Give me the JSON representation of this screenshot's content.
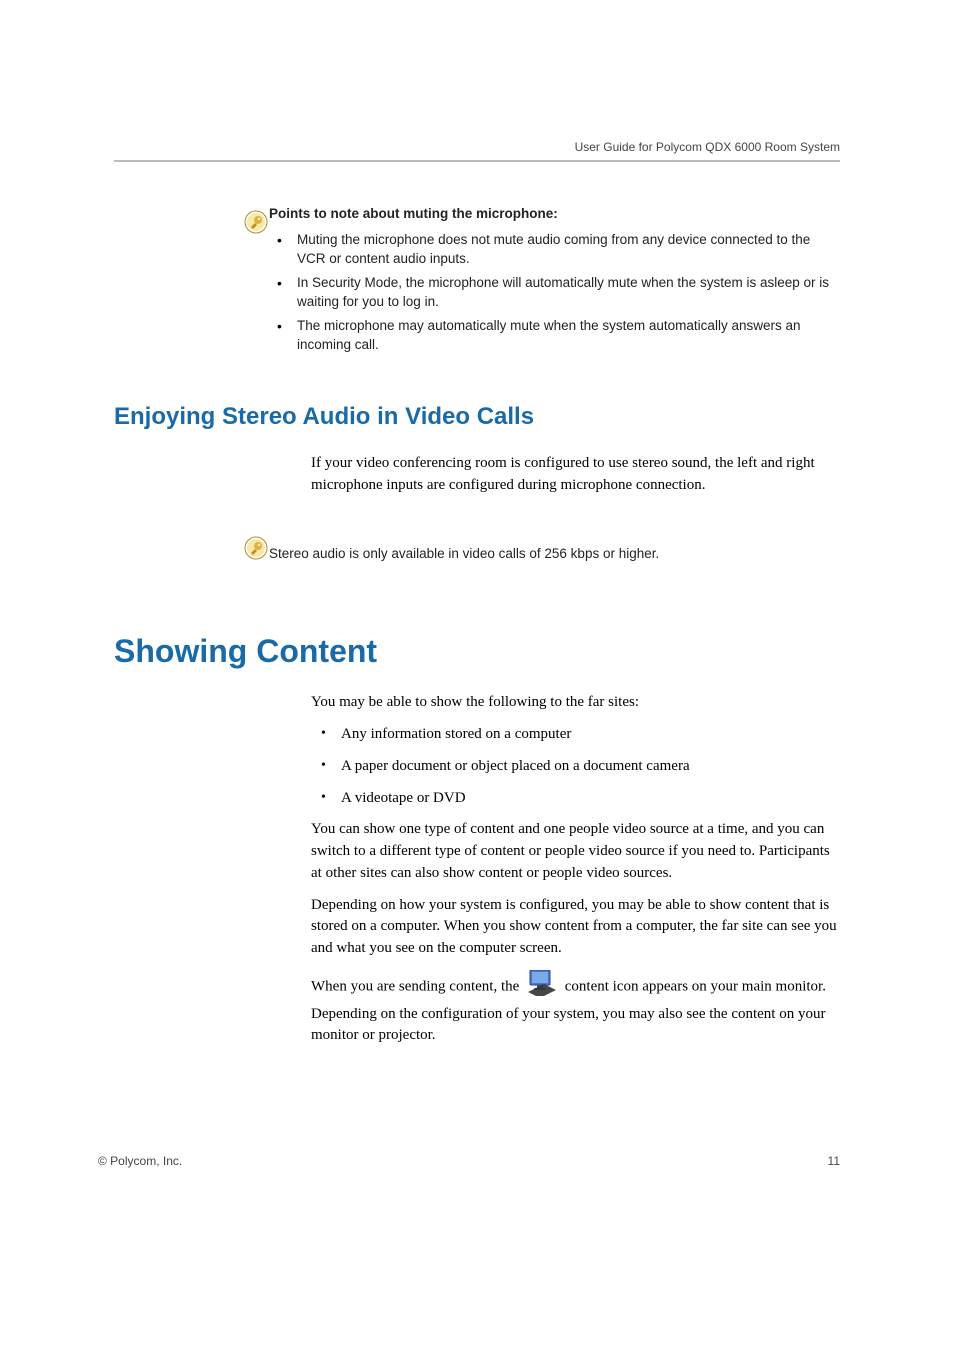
{
  "header": {
    "title": "User Guide for Polycom QDX 6000 Room System"
  },
  "note1": {
    "title": "Points to note about muting the microphone:",
    "items": [
      "Muting the microphone does not mute audio coming from any device connected to the VCR or content audio inputs.",
      "In Security Mode, the microphone will automatically mute when the system is asleep or is waiting for you to log in.",
      "The microphone may automatically mute when the system automatically answers an incoming call."
    ]
  },
  "section1": {
    "title": "Enjoying Stereo Audio in Video Calls",
    "para1": "If your video conferencing room is configured to use stereo sound, the left and right microphone inputs are configured during microphone connection."
  },
  "note2": {
    "text": "Stereo audio is only available in video calls of 256 kbps or higher."
  },
  "section2": {
    "title": "Showing Content",
    "intro": "You may be able to show the following to the far sites:",
    "items": [
      "Any information stored on a computer",
      "A paper document or object placed on a document camera",
      "A videotape or DVD"
    ],
    "para2": "You can show one type of content and one people video source at a time, and you can switch to a different type of content or people video source if you need to. Participants at other sites can also show content or people video sources.",
    "para3": "Depending on how your system is configured, you may be able to show content that is stored on a computer. When you show content from a computer, the far site can see you and what you see on the computer screen.",
    "para4a": "When you are sending content, the",
    "para4b": "content icon appears on your main monitor. Depending on the configuration of your system, you may also see the content on your monitor or projector."
  },
  "footer": {
    "copyright": "© Polycom, Inc.",
    "page": "11"
  }
}
